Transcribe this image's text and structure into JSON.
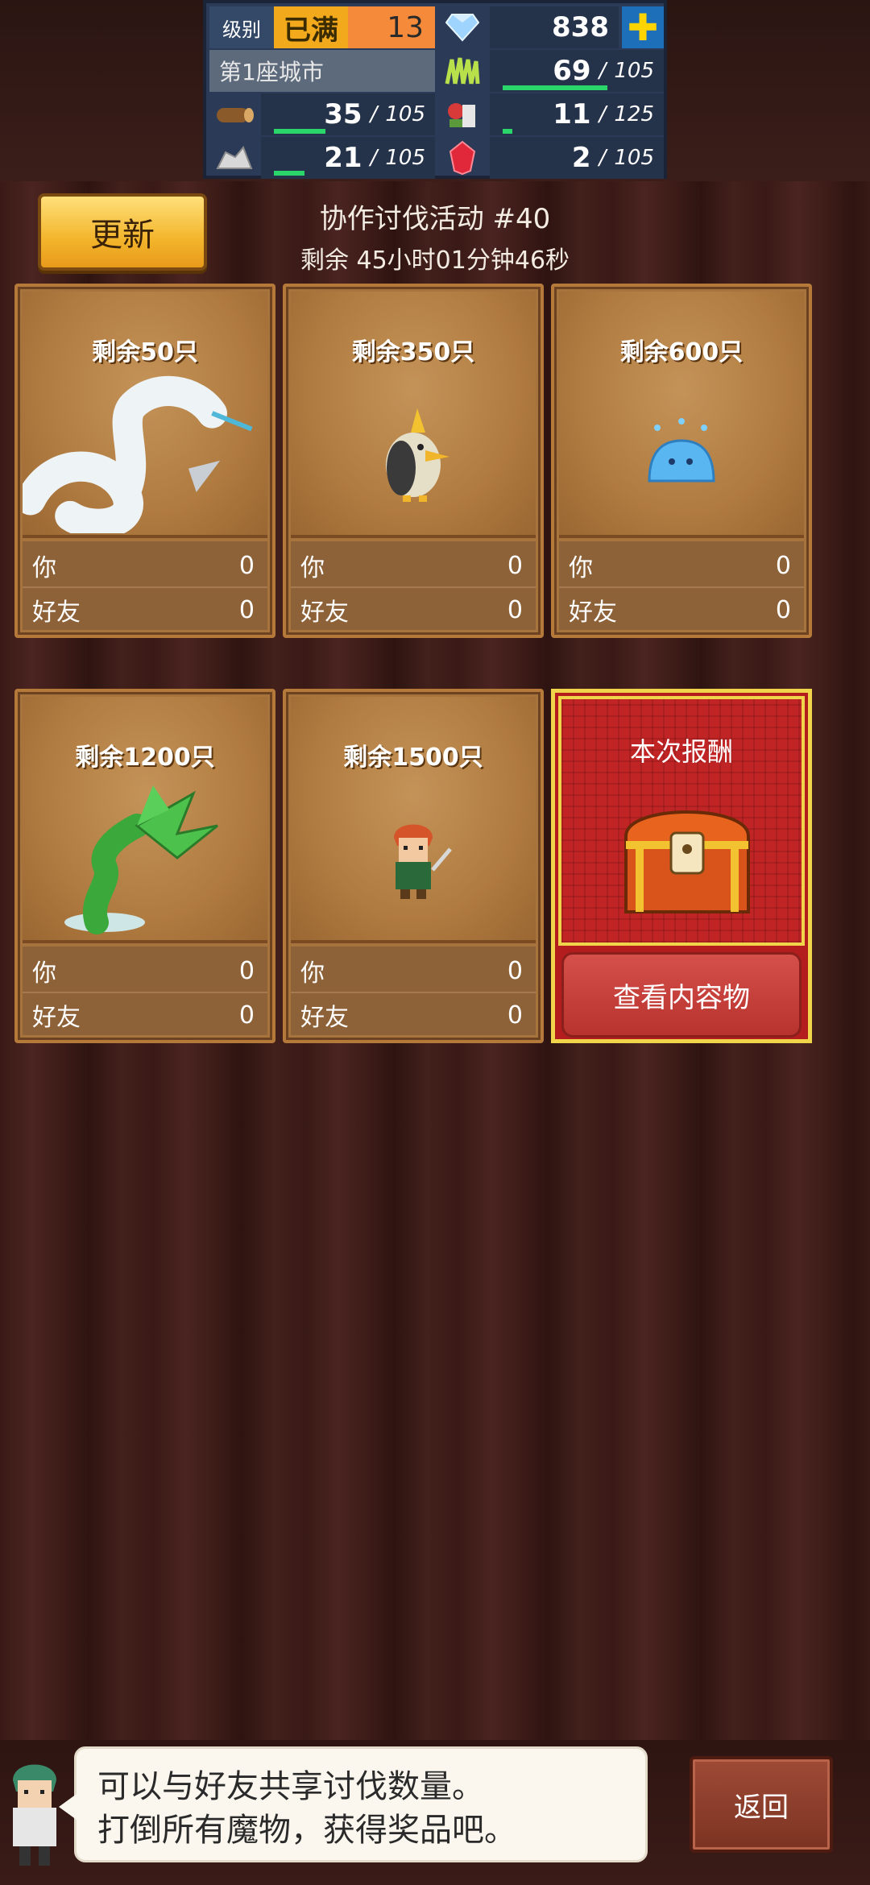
{
  "status": {
    "level_label": "级别",
    "level_max": "已满",
    "level_value": "13",
    "gems": "838",
    "city": "第1座城市",
    "resources": [
      {
        "icon": "grass-icon",
        "current": "69",
        "max": "105",
        "fill": 0.66
      },
      {
        "icon": "wood-icon",
        "current": "35",
        "max": "105",
        "fill": 0.33
      },
      {
        "icon": "food-icon",
        "current": "11",
        "max": "125",
        "fill": 0.09
      },
      {
        "icon": "ore-icon",
        "current": "21",
        "max": "105",
        "fill": 0.2
      },
      {
        "icon": "ruby-icon",
        "current": "2",
        "max": "105",
        "fill": 0.02
      }
    ]
  },
  "header": {
    "refresh_label": "更新",
    "title": "协作讨伐活动 #40",
    "time_left": "剩余 45小时01分钟46秒"
  },
  "cards": [
    {
      "remain": "剩余50只",
      "monster": "white-serpent-icon",
      "you_label": "你",
      "you": "0",
      "friend_label": "好友",
      "friend": "0"
    },
    {
      "remain": "剩余350只",
      "monster": "crested-bird-icon",
      "you_label": "你",
      "you": "0",
      "friend_label": "好友",
      "friend": "0"
    },
    {
      "remain": "剩余600只",
      "monster": "blue-slime-icon",
      "you_label": "你",
      "you": "0",
      "friend_label": "好友",
      "friend": "0"
    },
    {
      "remain": "剩余1200只",
      "monster": "green-plant-icon",
      "you_label": "你",
      "you": "0",
      "friend_label": "好友",
      "friend": "0"
    },
    {
      "remain": "剩余1500只",
      "monster": "red-hair-warrior-icon",
      "you_label": "你",
      "you": "0",
      "friend_label": "好友",
      "friend": "0"
    }
  ],
  "reward": {
    "title": "本次报酬",
    "view_label": "查看内容物"
  },
  "footer": {
    "message_line1": "可以与好友共享讨伐数量。",
    "message_line2": "打倒所有魔物，获得奖品吧。",
    "back_label": "返回"
  }
}
